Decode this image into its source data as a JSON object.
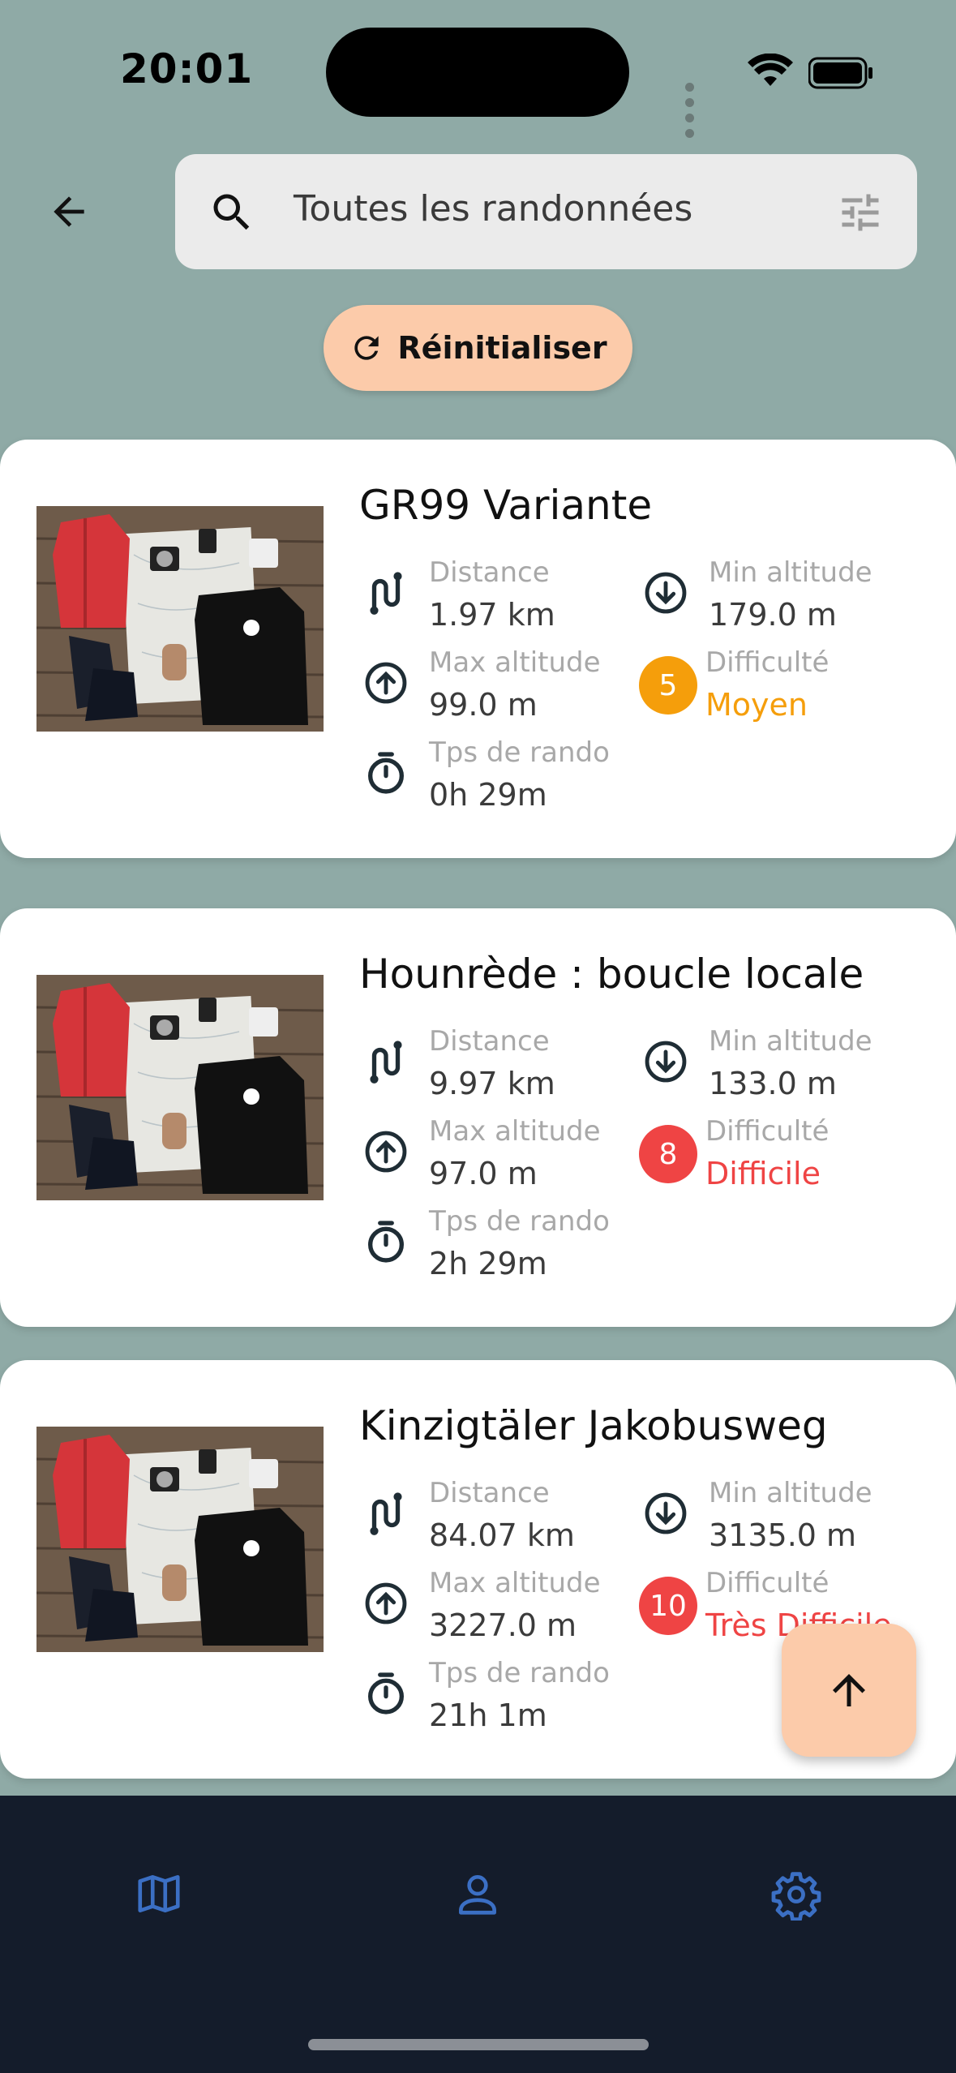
{
  "status_bar": {
    "time": "20:01"
  },
  "header": {
    "search_placeholder": "Toutes les randonnées",
    "reset_label": "Réinitialiser"
  },
  "stat_labels": {
    "distance": "Distance",
    "max_altitude": "Max altitude",
    "duration": "Tps de rando",
    "min_altitude": "Min altitude",
    "difficulty": "Difficulté"
  },
  "hikes": [
    {
      "title": "GR99 Variante",
      "distance": "1.97 km",
      "max_altitude": "99.0 m",
      "duration": "0h 29m",
      "min_altitude": "179.0 m",
      "difficulty_level": "5",
      "difficulty_label": "Moyen",
      "difficulty_color": "#f59e0b"
    },
    {
      "title": "Hounrède : boucle locale",
      "distance": "9.97 km",
      "max_altitude": "97.0 m",
      "duration": "2h 29m",
      "min_altitude": "133.0 m",
      "difficulty_level": "8",
      "difficulty_label": "Difficile",
      "difficulty_color": "#ef4444"
    },
    {
      "title": "Kinzigtäler Jakobusweg",
      "distance": "84.07 km",
      "max_altitude": "3227.0 m",
      "duration": "21h 1m",
      "min_altitude": "3135.0 m",
      "difficulty_level": "10",
      "difficulty_label": "Très Difficile",
      "difficulty_color": "#ef4444"
    }
  ],
  "nav": {
    "items": [
      "map-icon",
      "profile-icon",
      "settings-icon"
    ],
    "color": "#3b6fc4"
  }
}
